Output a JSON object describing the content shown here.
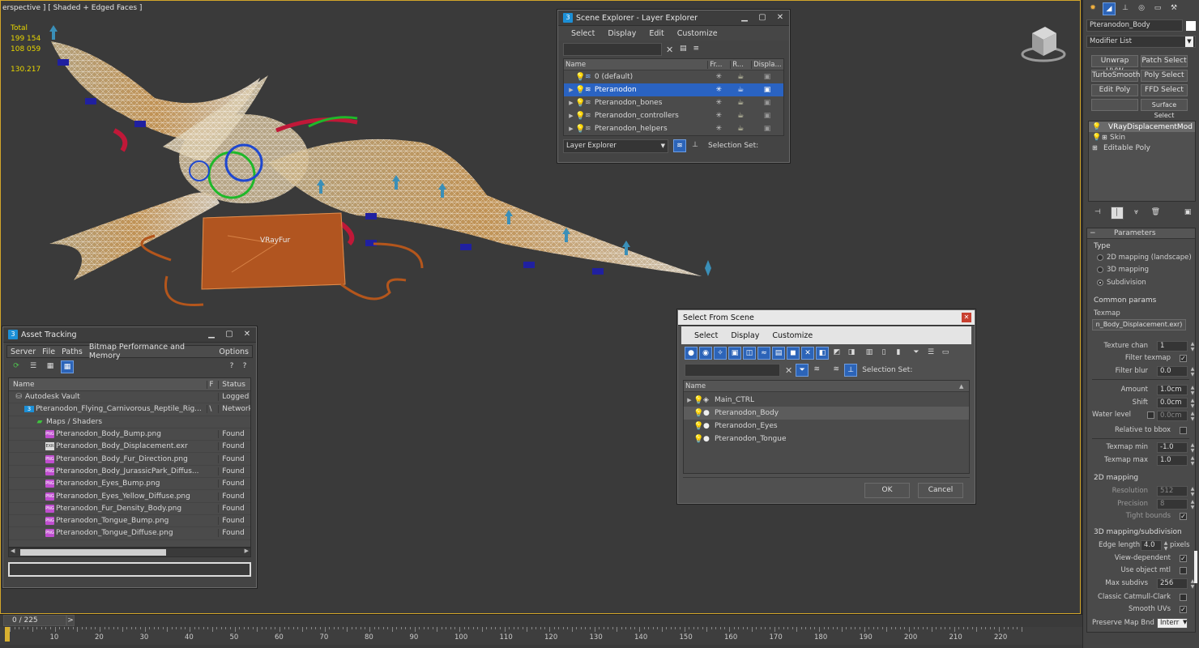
{
  "viewport": {
    "label": "erspective ] [ Shaded + Edged Faces ]",
    "stats": {
      "total_label": "Total",
      "polys": "199 154",
      "verts": "108 059",
      "fps": "130.217"
    },
    "fur_label": "VRayFur"
  },
  "scene_explorer": {
    "title": "Scene Explorer - Layer Explorer",
    "menu": [
      "Select",
      "Display",
      "Edit",
      "Customize"
    ],
    "search_placeholder": "",
    "columns": [
      "Name",
      "Fr...",
      "R...",
      "Displa..."
    ],
    "rows": [
      {
        "name": "0 (default)",
        "expand": ""
      },
      {
        "name": "Pteranodon",
        "expand": "▶"
      },
      {
        "name": "Pteranodon_bones",
        "expand": "▶"
      },
      {
        "name": "Pteranodon_controllers",
        "expand": "▶"
      },
      {
        "name": "Pteranodon_helpers",
        "expand": "▶"
      }
    ],
    "footer_dropdown": "Layer Explorer",
    "selection_set_label": "Selection Set:"
  },
  "asset_tracking": {
    "title": "Asset Tracking",
    "menu": [
      "Server",
      "File",
      "Paths",
      "Bitmap Performance and Memory",
      "Options"
    ],
    "columns": [
      "Name",
      "F",
      "Status"
    ],
    "rows": [
      {
        "name": "Autodesk Vault",
        "f": "",
        "status": "Logged",
        "indent": 0,
        "icon": "vault"
      },
      {
        "name": "Pteranodon_Flying_Carnivorous_Reptile_Rig...",
        "f": "\\",
        "status": "Network",
        "indent": 1,
        "icon": "max"
      },
      {
        "name": "Maps / Shaders",
        "f": "",
        "status": "",
        "indent": 2,
        "icon": "maps"
      },
      {
        "name": "Pteranodon_Body_Bump.png",
        "f": "",
        "status": "Found",
        "indent": 3,
        "icon": "png"
      },
      {
        "name": "Pteranodon_Body_Displacement.exr",
        "f": "",
        "status": "Found",
        "indent": 3,
        "icon": "exr"
      },
      {
        "name": "Pteranodon_Body_Fur_Direction.png",
        "f": "",
        "status": "Found",
        "indent": 3,
        "icon": "png"
      },
      {
        "name": "Pteranodon_Body_JurassicPark_Diffus...",
        "f": "",
        "status": "Found",
        "indent": 3,
        "icon": "png"
      },
      {
        "name": "Pteranodon_Eyes_Bump.png",
        "f": "",
        "status": "Found",
        "indent": 3,
        "icon": "png"
      },
      {
        "name": "Pteranodon_Eyes_Yellow_Diffuse.png",
        "f": "",
        "status": "Found",
        "indent": 3,
        "icon": "png"
      },
      {
        "name": "Pteranodon_Fur_Density_Body.png",
        "f": "",
        "status": "Found",
        "indent": 3,
        "icon": "png"
      },
      {
        "name": "Pteranodon_Tongue_Bump.png",
        "f": "",
        "status": "Found",
        "indent": 3,
        "icon": "png"
      },
      {
        "name": "Pteranodon_Tongue_Diffuse.png",
        "f": "",
        "status": "Found",
        "indent": 3,
        "icon": "png"
      }
    ]
  },
  "select_from_scene": {
    "title": "Select From Scene",
    "menu": [
      "Select",
      "Display",
      "Customize"
    ],
    "selection_set_label": "Selection Set:",
    "column": "Name",
    "rows": [
      {
        "name": "Main_CTRL",
        "expand": "▶"
      },
      {
        "name": "Pteranodon_Body",
        "expand": ""
      },
      {
        "name": "Pteranodon_Eyes",
        "expand": ""
      },
      {
        "name": "Pteranodon_Tongue",
        "expand": ""
      }
    ],
    "ok_label": "OK",
    "cancel_label": "Cancel"
  },
  "command_panel": {
    "object_name": "Pteranodon_Body",
    "modifier_list": "Modifier List",
    "mod_buttons": [
      "Unwrap UVW",
      "Patch Select",
      "TurboSmooth",
      "Poly Select",
      "Edit Poly",
      "FFD Select",
      "",
      "Surface Select"
    ],
    "stack": [
      "VRayDisplacementMod",
      "Skin",
      "Editable Poly"
    ],
    "parameters_title": "Parameters",
    "type_label": "Type",
    "type_options": [
      "2D mapping (landscape)",
      "3D mapping",
      "Subdivision"
    ],
    "common_params_label": "Common params",
    "texmap_label": "Texmap",
    "texmap_value": "n_Body_Displacement.exr)",
    "texture_chan_label": "Texture chan",
    "texture_chan_value": "1",
    "filter_texmap_label": "Filter texmap",
    "filter_blur_label": "Filter blur",
    "filter_blur_value": "0.0",
    "amount_label": "Amount",
    "amount_value": "1.0cm",
    "shift_label": "Shift",
    "shift_value": "0.0cm",
    "water_level_label": "Water level",
    "water_level_value": "0.0cm",
    "relative_bbox_label": "Relative to bbox",
    "texmap_min_label": "Texmap min",
    "texmap_min_value": "-1.0",
    "texmap_max_label": "Texmap max",
    "texmap_max_value": "1.0",
    "mapping2d_label": "2D mapping",
    "resolution_label": "Resolution",
    "resolution_value": "512",
    "precision_label": "Precision",
    "precision_value": "8",
    "tight_bounds_label": "Tight bounds",
    "mapping3d_label": "3D mapping/subdivision",
    "edge_length_label": "Edge length",
    "edge_length_value": "4.0",
    "pixels_label": "pixels",
    "view_dependent_label": "View-dependent",
    "use_object_mtl_label": "Use object mtl",
    "max_subdivs_label": "Max subdivs",
    "max_subdivs_value": "256",
    "classic_catmull_label": "Classic Catmull-Clark",
    "smooth_uvs_label": "Smooth UVs",
    "preserve_map_label": "Preserve Map Bnd",
    "preserve_map_value": "Interr"
  },
  "timeline": {
    "frame_counter": "0 / 225",
    "next": ">",
    "ticks": [
      "10",
      "20",
      "30",
      "40",
      "50",
      "60",
      "70",
      "80",
      "90",
      "100",
      "110",
      "120",
      "130",
      "140",
      "150",
      "160",
      "170",
      "180",
      "190",
      "200",
      "210",
      "220"
    ]
  },
  "colors": {
    "viewport_bg": "#3a3a3a",
    "selection_blue": "#2a63c2",
    "stats_yellow": "#e8d600",
    "viewport_border": "#d2a52a"
  }
}
